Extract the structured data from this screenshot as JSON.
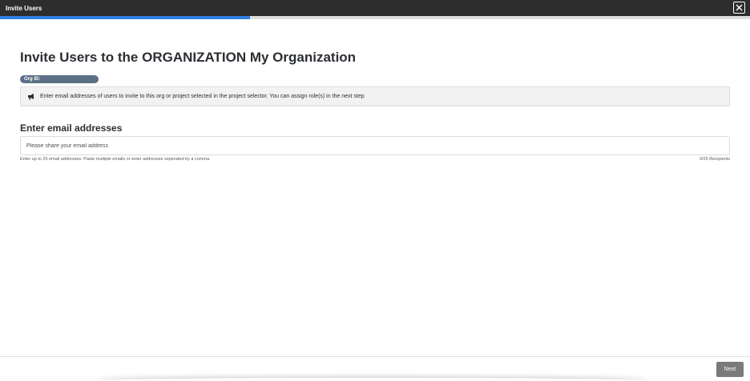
{
  "window": {
    "title": "Invite Users",
    "close_icon": "close-icon"
  },
  "progress": {
    "fraction": 0.333
  },
  "main": {
    "title": "Invite Users to the ORGANIZATION My Organization",
    "org_id_label": "Org ID:",
    "info": {
      "icon": "megaphone-icon",
      "text": "Enter email addresses of users to invite to this org or project selected in the project selector. You can assign role(s) in the next step"
    },
    "email_section": {
      "heading": "Enter email addresses",
      "input_value": "",
      "placeholder": "Please share your email address",
      "hint": "Enter up to 25 email addresses. Paste multiple emails or enter addresses seperated by a comma.",
      "recipients": "0/25 Recipients"
    }
  },
  "footer": {
    "next_label": "Next"
  },
  "colors": {
    "titlebar": "#2d2d2d",
    "accent": "#2f7fe3",
    "pill": "#5c6f86",
    "next_button": "#7a7a7a"
  }
}
